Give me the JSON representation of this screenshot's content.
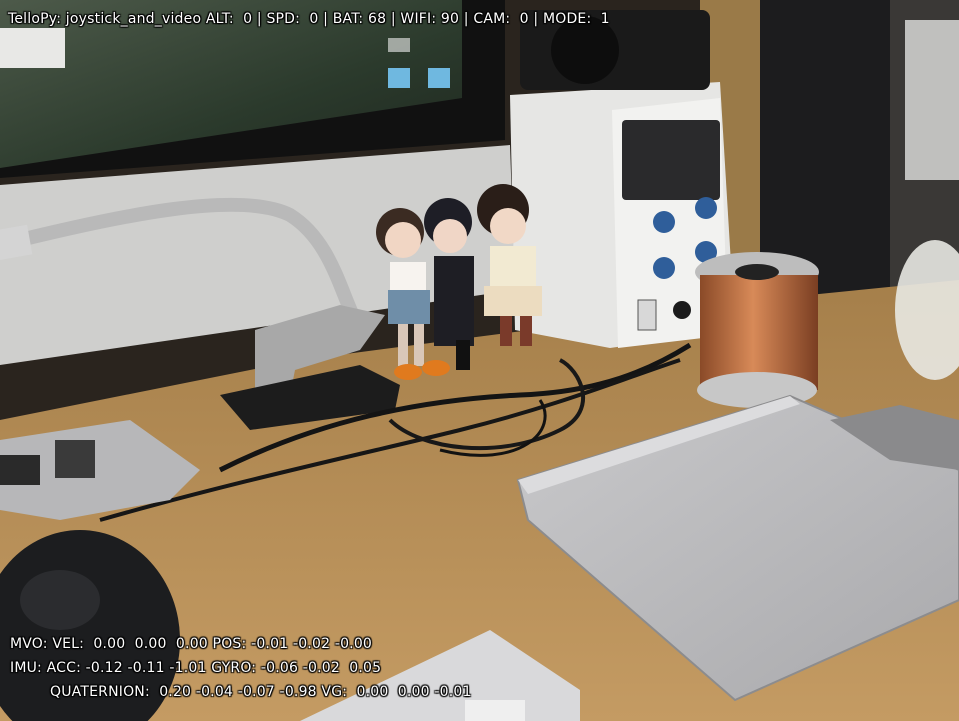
{
  "window_title": "TelloPy: joystick_and_video",
  "status_bar": {
    "text": "TelloPy: joystick_and_video ALT:  0 | SPD:  0 | BAT: 68 | WIFI: 90 | CAM:  0 | MODE:  1",
    "altitude": 0,
    "speed": 0,
    "battery": 68,
    "wifi": 90,
    "camera": 0,
    "mode": 1
  },
  "telemetry": {
    "mvo_line": "MVO: VEL:  0.00  0.00  0.00 POS: -0.01 -0.02 -0.00",
    "imu_line": "IMU: ACC: -0.12 -0.11 -1.01 GYRO: -0.06 -0.02  0.05",
    "quaternion_line": "QUATERNION:  0.20 -0.04 -0.07 -0.98 VG:  0.00  0.00 -0.01"
  },
  "colors": {
    "hud_text": "#ffffff",
    "desk": "#b8925a",
    "wall": "#cfcfcd",
    "copper": "#b9683c"
  }
}
